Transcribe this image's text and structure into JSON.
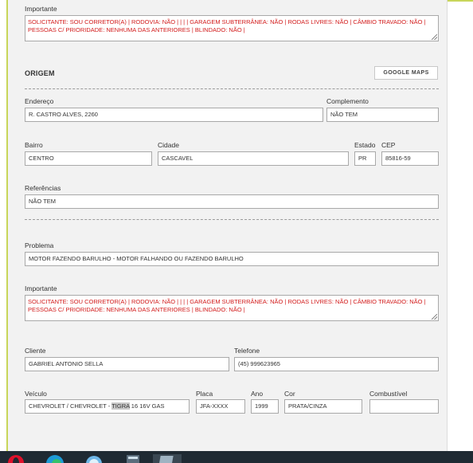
{
  "importante_top": {
    "label": "Importante",
    "value": "SOLICITANTE: SOU CORRETOR(A) | RODOVIA: NÃO | | | | GARAGEM SUBTERRÂNEA: NÃO | RODAS LIVRES: NÃO | CÂMBIO TRAVADO: NÃO | PESSOAS C/ PRIORIDADE: NENHUMA DAS ANTERIORES | BLINDADO: NÃO |"
  },
  "origem": {
    "title": "ORIGEM",
    "maps_button": "GOOGLE MAPS",
    "endereco_label": "Endereço",
    "endereco_value": "R. CASTRO ALVES, 2260",
    "complemento_label": "Complemento",
    "complemento_value": "NÃO TEM",
    "bairro_label": "Bairro",
    "bairro_value": "CENTRO",
    "cidade_label": "Cidade",
    "cidade_value": "CASCAVEL",
    "estado_label": "Estado",
    "estado_value": "PR",
    "cep_label": "CEP",
    "cep_value": "85816-59",
    "referencias_label": "Referências",
    "referencias_value": "NÃO TEM"
  },
  "problema": {
    "label": "Problema",
    "value": "MOTOR FAZENDO BARULHO - MOTOR FALHANDO OU FAZENDO BARULHO"
  },
  "importante_bottom": {
    "label": "Importante",
    "value": "SOLICITANTE: SOU CORRETOR(A) | RODOVIA: NÃO | | | | GARAGEM SUBTERRÂNEA: NÃO | RODAS LIVRES: NÃO | CÂMBIO TRAVADO: NÃO | PESSOAS C/ PRIORIDADE: NENHUMA DAS ANTERIORES | BLINDADO: NÃO |"
  },
  "cliente": {
    "label": "Cliente",
    "value": "GABRIEL ANTONIO SELLA",
    "telefone_label": "Telefone",
    "telefone_value": "(45) 999623965"
  },
  "veiculo": {
    "label": "Veículo",
    "value_prefix": "CHEVROLET / CHEVROLET - ",
    "value_highlight": "TIGRA",
    "value_suffix": " 16 16V GAS",
    "placa_label": "Placa",
    "placa_value": "JFA-XXXX",
    "ano_label": "Ano",
    "ano_value": "1999",
    "cor_label": "Cor",
    "cor_value": "PRATA/CINZA",
    "combustivel_label": "Combustível",
    "combustivel_value": ""
  },
  "taskbar": {
    "icons": [
      "opera-icon",
      "edge-icon",
      "ie-icon",
      "calculator-icon",
      "app-icon"
    ]
  }
}
